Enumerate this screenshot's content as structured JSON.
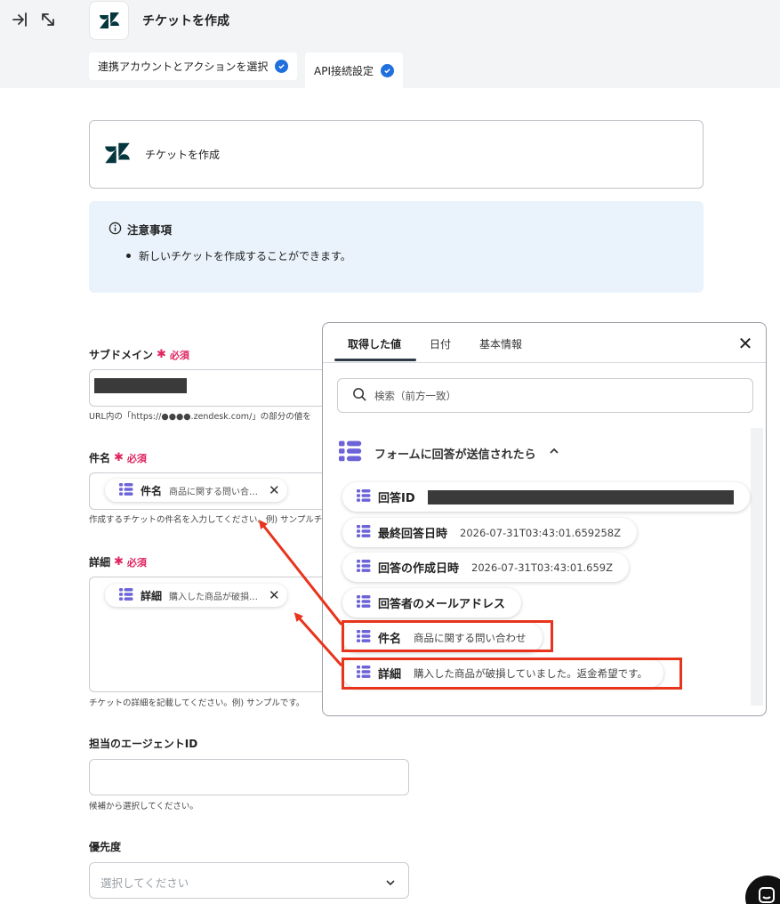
{
  "header": {
    "title": "チケットを作成",
    "tabs": [
      {
        "label": "連携アカウントとアクションを選択"
      },
      {
        "label": "API接続設定"
      }
    ]
  },
  "action_card": {
    "title": "チケットを作成"
  },
  "notice": {
    "heading": "注意事項",
    "items": [
      "新しいチケットを作成することができます。"
    ]
  },
  "form": {
    "subdomain": {
      "label": "サブドメイン",
      "required": "必須",
      "hint": "URL内の「https://●●●●.zendesk.com/」の部分の値を"
    },
    "subject": {
      "label": "件名",
      "required": "必須",
      "chip_key": "件名",
      "chip_value": "商品に関する問い合…",
      "hint": "作成するチケットの件名を入力してください。例) サンプルチ"
    },
    "detail": {
      "label": "詳細",
      "required": "必須",
      "chip_key": "詳細",
      "chip_value": "購入した商品が破損…",
      "hint": "チケットの詳細を記載してください。例) サンプルです。"
    },
    "agent": {
      "label": "担当のエージェントID",
      "hint": "候補から選択してください。"
    },
    "priority": {
      "label": "優先度",
      "placeholder": "選択してください"
    }
  },
  "panel": {
    "tabs": [
      {
        "label": "取得した値"
      },
      {
        "label": "日付"
      },
      {
        "label": "基本情報"
      }
    ],
    "search_placeholder": "検索（前方一致）",
    "group_label": "フォームに回答が送信されたら",
    "items": [
      {
        "key": "回答ID",
        "value": ""
      },
      {
        "key": "最終回答日時",
        "value": "2026-07-31T03:43:01.659258Z"
      },
      {
        "key": "回答の作成日時",
        "value": "2026-07-31T03:43:01.659Z"
      },
      {
        "key": "回答者のメールアドレス",
        "value": ""
      },
      {
        "key": "件名",
        "value": "商品に関する問い合わせ"
      },
      {
        "key": "詳細",
        "value": "購入した商品が破損していました。返金希望です。"
      }
    ]
  },
  "colors": {
    "accent": "#1f6fde",
    "highlight": "#e8341c",
    "required": "#e0245e",
    "notice_bg": "#eaf3fb",
    "tag_icon": "#6c63d9"
  }
}
